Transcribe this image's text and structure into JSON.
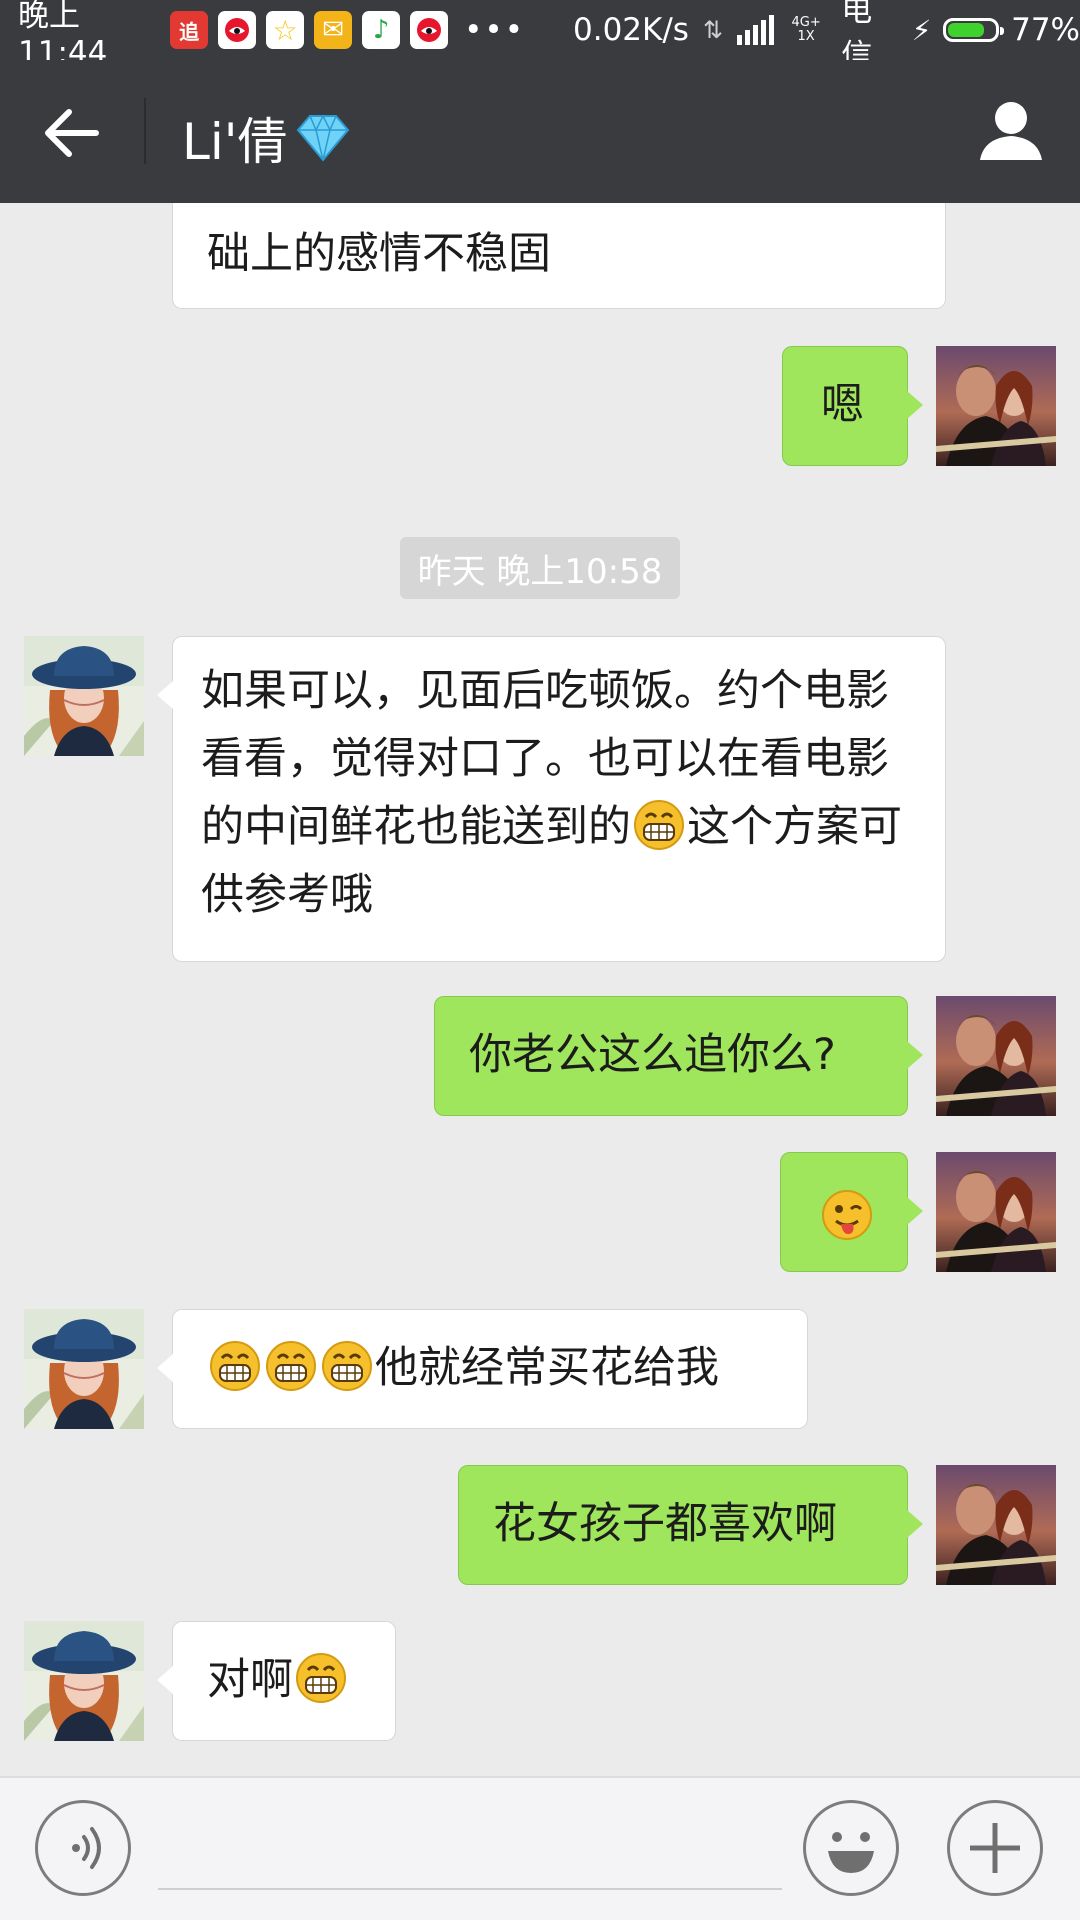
{
  "status_bar": {
    "time": "晚上11:44",
    "app_icons": [
      {
        "name": "zhui-app-icon",
        "glyph": "追",
        "color": "#e23a32"
      },
      {
        "name": "weibo-icon",
        "glyph": "",
        "color": "#ffffff"
      },
      {
        "name": "star-app-icon",
        "glyph": "☆",
        "color": "#f3c91c"
      },
      {
        "name": "mail-icon",
        "glyph": "✉",
        "color": "#f2b418"
      },
      {
        "name": "music-app-icon",
        "glyph": "♪",
        "color": "#f7d22e"
      },
      {
        "name": "weibo-icon-2",
        "glyph": "",
        "color": "#ffffff"
      }
    ],
    "more": "•••",
    "speed": "0.02K/s",
    "network": "4G+ 1X",
    "carrier": "电信",
    "battery_percent": "77%",
    "battery_level": 0.77
  },
  "header": {
    "title": "Li'倩"
  },
  "chat": {
    "partial_message": "础上的感情不稳固",
    "timestamp": "昨天 晚上10:58",
    "messages": [
      {
        "side": "right",
        "text": "嗯"
      },
      {
        "side": "left",
        "text_parts": [
          "如果可以，见面后吃顿饭。约个电影看看，觉得对口了。也可以在看电影的中间鲜花也能送到的",
          "这个方案可供参考哦"
        ]
      },
      {
        "side": "right",
        "text": "你老公这么追你么?"
      },
      {
        "side": "right",
        "emoji": "winking-tongue-emoji"
      },
      {
        "side": "left",
        "text": "他就经常买花给我"
      },
      {
        "side": "right",
        "text": "花女孩子都喜欢啊"
      },
      {
        "side": "left",
        "text": "对啊"
      }
    ]
  },
  "colors": {
    "header_bg": "#3a3b3f",
    "chat_bg": "#ebebeb",
    "sent_bubble": "#9fe65d",
    "received_bubble": "#ffffff",
    "timestamp_bg": "#d6d6d6"
  }
}
